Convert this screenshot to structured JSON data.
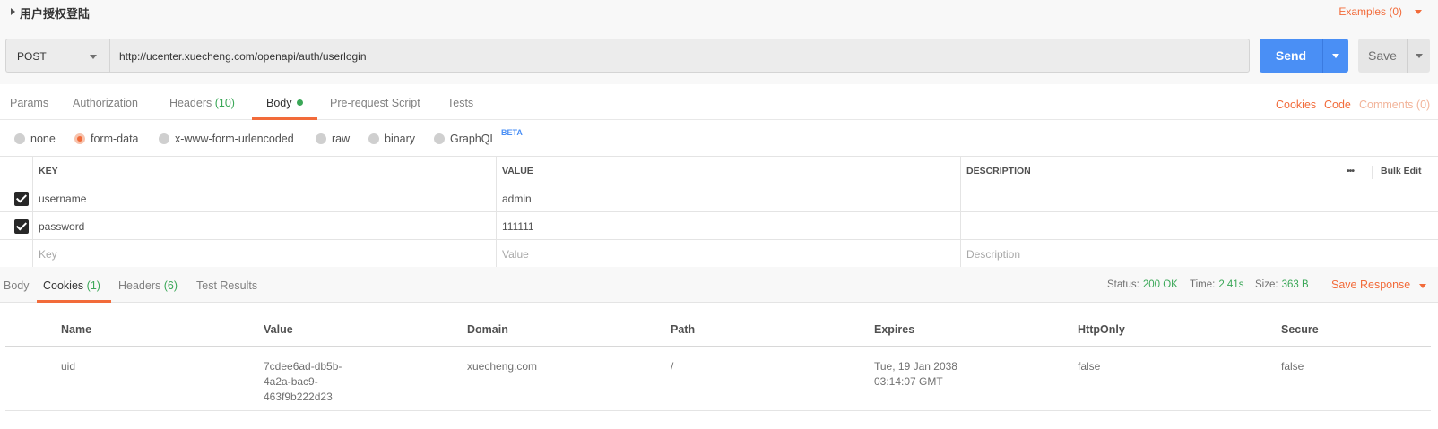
{
  "request": {
    "title": "用户授权登陆",
    "examples_label": "Examples (0)",
    "method": "POST",
    "url": "http://ucenter.xuecheng.com/openapi/auth/userlogin",
    "send_label": "Send",
    "save_label": "Save"
  },
  "req_tabs": {
    "params": "Params",
    "authorization": "Authorization",
    "headers": "Headers",
    "headers_count": "(10)",
    "body": "Body",
    "prerequest": "Pre-request Script",
    "tests": "Tests",
    "cookies": "Cookies",
    "code": "Code",
    "comments": "Comments (0)"
  },
  "body_types": {
    "none": "none",
    "form_data": "form-data",
    "urlencoded": "x-www-form-urlencoded",
    "raw": "raw",
    "binary": "binary",
    "graphql": "GraphQL",
    "beta": "BETA",
    "selected": "form-data"
  },
  "params": {
    "headers": {
      "key": "KEY",
      "value": "VALUE",
      "description": "DESCRIPTION"
    },
    "bulk_edit": "Bulk Edit",
    "rows": [
      {
        "checked": true,
        "key": "username",
        "value": "admin",
        "description": ""
      },
      {
        "checked": true,
        "key": "password",
        "value": "111111",
        "description": ""
      }
    ],
    "placeholder": {
      "key": "Key",
      "value": "Value",
      "description": "Description"
    }
  },
  "response": {
    "tabs": {
      "body": "Body",
      "cookies": "Cookies",
      "cookies_count": "(1)",
      "headers": "Headers",
      "headers_count": "(6)",
      "test_results": "Test Results"
    },
    "status_label": "Status:",
    "status_value": "200 OK",
    "time_label": "Time:",
    "time_value": "2.41s",
    "size_label": "Size:",
    "size_value": "363 B",
    "save_response": "Save Response"
  },
  "cookies": {
    "columns": [
      "Name",
      "Value",
      "Domain",
      "Path",
      "Expires",
      "HttpOnly",
      "Secure"
    ],
    "rows": [
      {
        "name": "uid",
        "value_lines": [
          "7cdee6ad-db5b-",
          "4a2a-bac9-",
          "463f9b222d23"
        ],
        "domain": "xuecheng.com",
        "path": "/",
        "expires_lines": [
          "Tue, 19 Jan 2038",
          "03:14:07 GMT"
        ],
        "httponly": "false",
        "secure": "false"
      }
    ]
  },
  "colors": {
    "accent": "#f26b3a",
    "send": "#4a8ff5",
    "success": "#3aa757"
  }
}
